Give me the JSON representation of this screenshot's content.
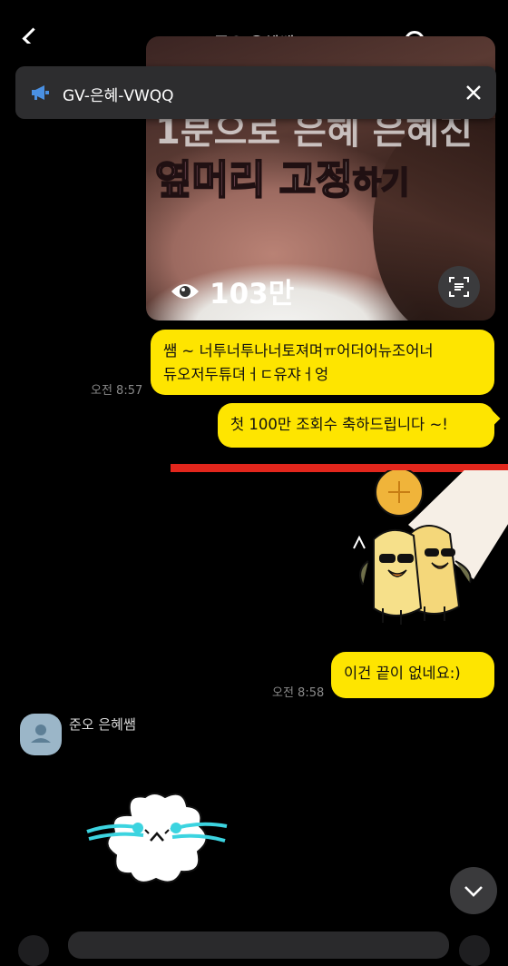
{
  "header": {
    "title": "준오 은혜쌤"
  },
  "banner": {
    "text": "GV-은혜-VWQQ"
  },
  "thumbnail": {
    "title_line1": "1분으로 은혜 은혜진",
    "title_pink": "옆머리",
    "title_white": "고정",
    "title_small": "하기",
    "views": "103만"
  },
  "messages": [
    {
      "line1": "쌤 ~ 너투너투나너토져며ㅠ어더어뉴조어너",
      "line2": "듀오저두튜뎌ㅓㄷ유쟈ㅓ엉",
      "time": "오전 8:57"
    },
    {
      "text": "첫 100만 조회수 축하드립니다 ~!"
    },
    {
      "text": "이건 끝이 없네요:)",
      "time": "오전 8:58"
    }
  ],
  "other_sender": {
    "name": "준오 은혜쌤"
  },
  "colors": {
    "bubble": "#fee500",
    "background": "#000000",
    "divider": "#e2261c"
  }
}
